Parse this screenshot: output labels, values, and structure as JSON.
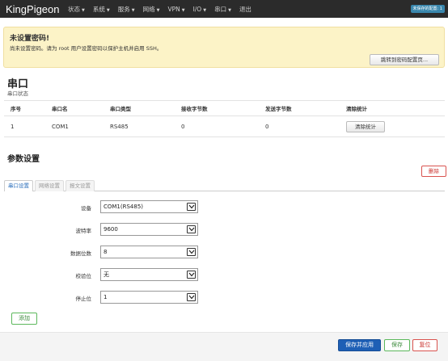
{
  "header": {
    "brand": "KingPigeon",
    "nav": [
      {
        "label": "状态",
        "caret": "▼"
      },
      {
        "label": "系统",
        "caret": "▼"
      },
      {
        "label": "服务",
        "caret": "▼"
      },
      {
        "label": "网络",
        "caret": "▼"
      },
      {
        "label": "VPN",
        "caret": "▼"
      },
      {
        "label": "I/O",
        "caret": "▼"
      },
      {
        "label": "串口",
        "caret": "▼"
      },
      {
        "label": "退出",
        "caret": ""
      }
    ],
    "badge": "未保存的配置: 1"
  },
  "alert": {
    "title": "未设置密码!",
    "message": "尚未设置密码。请为 root 用户设置密码以保护主机并启用 SSH。",
    "button": "跳转到密码配置页..."
  },
  "serial": {
    "title": "串口",
    "subtitle": "串口状态",
    "columns": [
      "序号",
      "串口名",
      "串口类型",
      "接收字节数",
      "发送字节数",
      "清除统计"
    ],
    "rows": [
      {
        "index": "1",
        "name": "COM1",
        "type": "RS485",
        "rx": "0",
        "tx": "0",
        "action": "清除统计"
      }
    ]
  },
  "params": {
    "title": "参数设置",
    "delete_button": "删除",
    "tabs": [
      "串口设置",
      "网络设置",
      "报文设置"
    ],
    "fields": [
      {
        "label": "设备",
        "value": "COM1(RS485)"
      },
      {
        "label": "波特率",
        "value": "9600"
      },
      {
        "label": "数据位数",
        "value": "8"
      },
      {
        "label": "校验位",
        "value": "无"
      },
      {
        "label": "停止位",
        "value": "1"
      }
    ],
    "add_button": "添加"
  },
  "footer": {
    "save_apply": "保存并应用",
    "save": "保存",
    "reset": "复位"
  },
  "colors": {
    "topbar": "#2b2b2b",
    "alert_bg": "#fcf3c7",
    "primary": "#1e5fb5",
    "success": "#5cb85c",
    "danger": "#d9534f",
    "tab_active": "#2a6ebb"
  }
}
